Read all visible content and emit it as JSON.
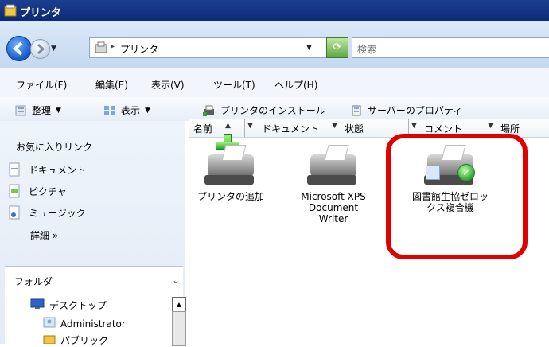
{
  "window": {
    "title": "プリンタ"
  },
  "address": {
    "path": "プリンタ",
    "separator": "▸",
    "search_placeholder": "検索"
  },
  "menu": [
    "ファイル(F)",
    "編集(E)",
    "表示(V)",
    "ツール(T)",
    "ヘルプ(H)"
  ],
  "toolbar": {
    "organize": "整理",
    "view": "表示",
    "install": "プリンタのインストール",
    "server": "サーバーのプロパティ",
    "chevron": "▼"
  },
  "sidebar": {
    "favorites_title": "お気に入りリンク",
    "favorites": [
      "ドキュメント",
      "ピクチャ",
      "ミュージック"
    ],
    "more": "詳細  »",
    "folders_title": "フォルダ",
    "folders_chevron": "⌄",
    "tree": [
      "デスクトップ",
      "Administrator",
      "パブリック"
    ]
  },
  "columns": [
    {
      "label": "名前",
      "sort": "▲"
    },
    {
      "label": "ドキュメント"
    },
    {
      "label": "状態"
    },
    {
      "label": "コメント"
    },
    {
      "label": "場所"
    }
  ],
  "printers": [
    {
      "label": "プリンタの追加"
    },
    {
      "label": "Microsoft XPS Document Writer"
    },
    {
      "label": "図書館生協ゼロックス複合機",
      "is_default": true
    }
  ],
  "colors": {
    "titlebar": "#0b2a78",
    "highlight": "#e10000"
  }
}
